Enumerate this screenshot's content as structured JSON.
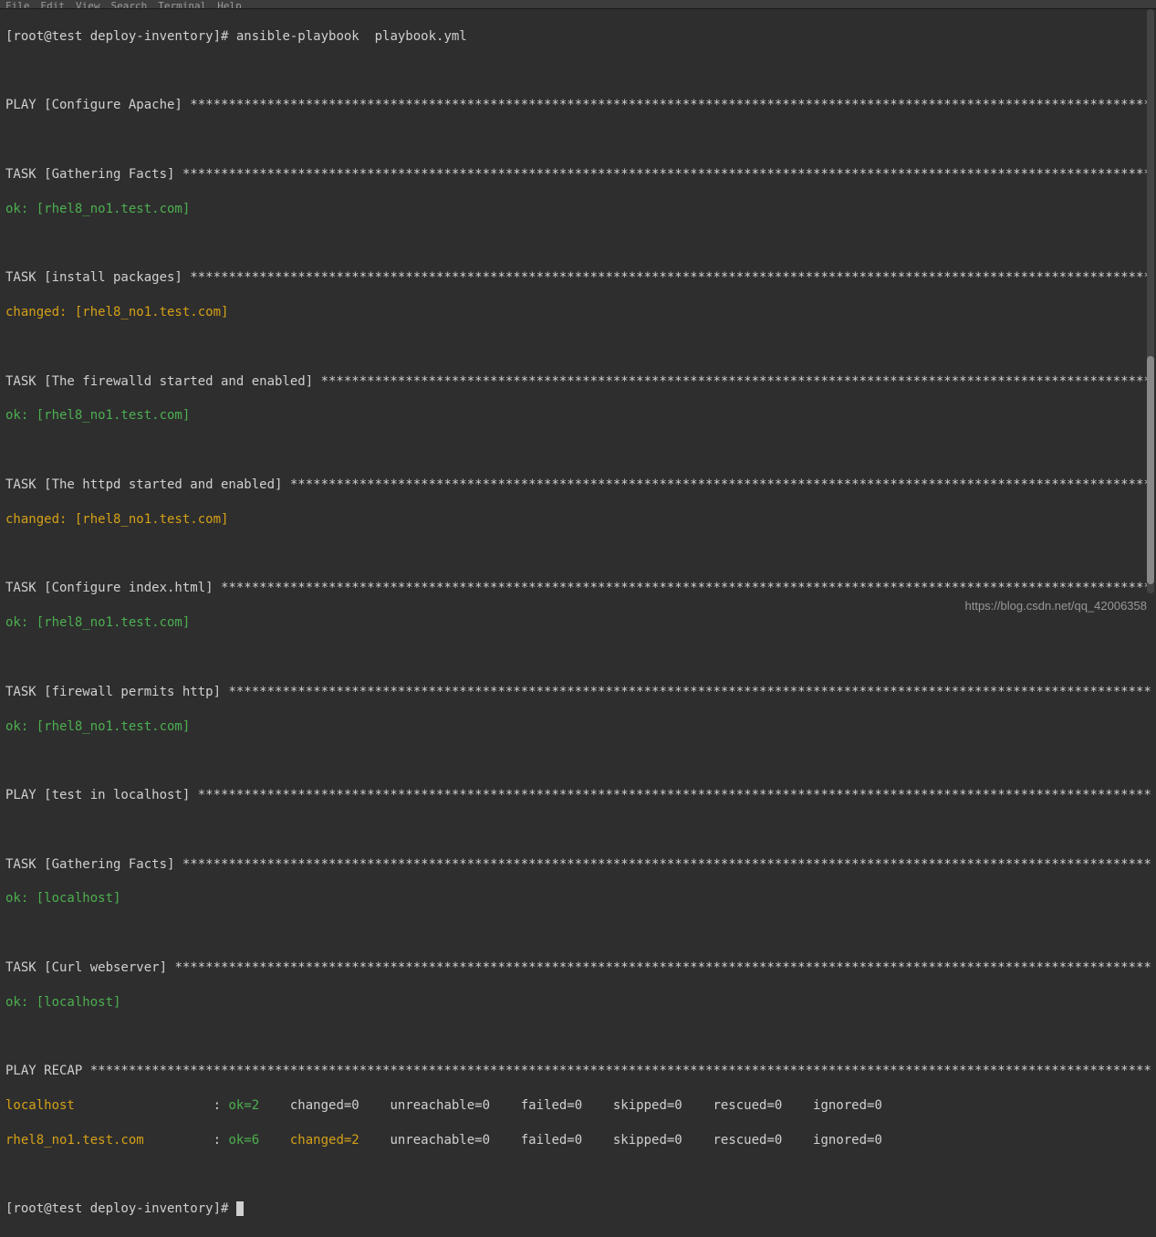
{
  "menubar": [
    "File",
    "Edit",
    "View",
    "Search",
    "Terminal",
    "Help"
  ],
  "prompt1": "[root@test deploy-inventory]# ",
  "command": "ansible-playbook  playbook.yml",
  "play1": "PLAY [Configure Apache] ",
  "task_gather1": "TASK [Gathering Facts] ",
  "ok_rhel": "ok: [rhel8_no1.test.com]",
  "task_install": "TASK [install packages] ",
  "changed_rhel": "changed: [rhel8_no1.test.com]",
  "task_firewalld": "TASK [The firewalld started and enabled] ",
  "task_httpd": "TASK [The httpd started and enabled] ",
  "task_index": "TASK [Configure index.html] ",
  "task_fwpermit": "TASK [firewall permits http] ",
  "play2": "PLAY [test in localhost] ",
  "task_gather2": "TASK [Gathering Facts] ",
  "ok_local": "ok: [localhost]",
  "task_curl": "TASK [Curl webserver] ",
  "recap_header": "PLAY RECAP ",
  "recap1_host": "localhost",
  "recap1_sep": "                  : ",
  "recap1_ok": "ok=2",
  "recap1_rest": "    changed=0    unreachable=0    failed=0    skipped=0    rescued=0    ignored=0",
  "recap2_host": "rhel8_no1.test.com",
  "recap2_sep": "         : ",
  "recap2_ok": "ok=6",
  "recap2_changed": "    changed=2",
  "recap2_rest": "    unreachable=0    failed=0    skipped=0    rescued=0    ignored=0",
  "prompt2": "[root@test deploy-inventory]# ",
  "watermark": "https://blog.csdn.net/qq_42006358"
}
